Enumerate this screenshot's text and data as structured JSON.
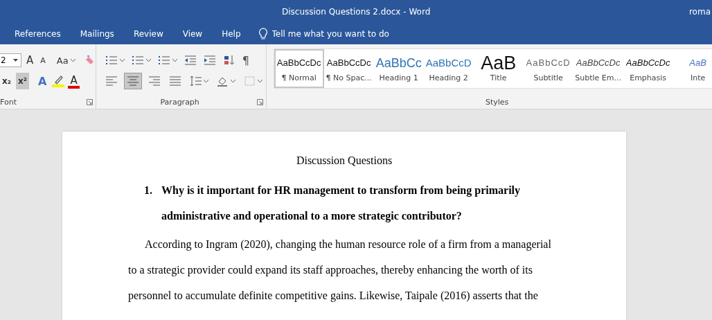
{
  "window": {
    "title": "Discussion Questions 2.docx  -  Word",
    "user": "roma"
  },
  "tabs": [
    {
      "label": "References",
      "selected": false
    },
    {
      "label": "Mailings",
      "selected": false
    },
    {
      "label": "Review",
      "selected": false
    },
    {
      "label": "View",
      "selected": false
    },
    {
      "label": "Help",
      "selected": false
    }
  ],
  "tell_me": {
    "placeholder": "Tell me what you want to do"
  },
  "font_group": {
    "label": "Font",
    "size": "2",
    "row1": [
      {
        "kind": "grow",
        "label": "A"
      },
      {
        "kind": "shrink",
        "label": "A"
      },
      {
        "kind": "case",
        "label": "Aa"
      },
      {
        "kind": "clear"
      }
    ],
    "row2": [
      {
        "kind": "subscript",
        "label": "x₂",
        "selected": false
      },
      {
        "kind": "superscript",
        "label": "x²",
        "selected": true
      },
      {
        "kind": "effects",
        "label": "A"
      },
      {
        "kind": "highlight"
      },
      {
        "kind": "color",
        "label": "A"
      }
    ]
  },
  "paragraph_group": {
    "label": "Paragraph",
    "row1": [
      {
        "kind": "bullets",
        "dropdown": true
      },
      {
        "kind": "numbering",
        "dropdown": true
      },
      {
        "kind": "multilevel",
        "dropdown": true
      },
      {
        "kind": "outdent",
        "dropdown": false
      },
      {
        "kind": "indent",
        "dropdown": false
      },
      {
        "kind": "sort",
        "dropdown": false
      },
      {
        "kind": "marks",
        "label": "¶",
        "dropdown": false
      }
    ],
    "row2": [
      {
        "kind": "align-left",
        "selected": false
      },
      {
        "kind": "align-center",
        "selected": true
      },
      {
        "kind": "align-right",
        "selected": false
      },
      {
        "kind": "justify",
        "selected": false
      },
      {
        "kind": "spacing",
        "selected": false
      },
      {
        "kind": "shading",
        "selected": false
      },
      {
        "kind": "borders",
        "selected": false
      }
    ]
  },
  "styles_group": {
    "label": "Styles",
    "items": [
      {
        "kind": "normal",
        "preview": "AaBbCcDc",
        "name": "¶ Normal",
        "selected": true
      },
      {
        "kind": "plain",
        "preview": "AaBbCcDc",
        "name": "¶ No Spac...",
        "selected": false
      },
      {
        "kind": "heading1",
        "preview": "AaBbCc",
        "name": "Heading 1",
        "selected": false
      },
      {
        "kind": "heading2",
        "preview": "AaBbCcD",
        "name": "Heading 2",
        "selected": false
      },
      {
        "kind": "title",
        "preview": "AaB",
        "name": "Title",
        "selected": false
      },
      {
        "kind": "subtitle",
        "preview": "AaBbCcD",
        "name": "Subtitle",
        "selected": false
      },
      {
        "kind": "subtle",
        "preview": "AaBbCcDc",
        "name": "Subtle Em...",
        "selected": false
      },
      {
        "kind": "emphasis",
        "preview": "AaBbCcDc",
        "name": "Emphasis",
        "selected": false
      },
      {
        "kind": "intense",
        "preview": "AaB",
        "name": "Inte",
        "selected": false
      }
    ]
  },
  "document": {
    "heading": "Discussion Questions",
    "question": {
      "number": "1.",
      "text": "Why is it important for HR management to transform from being primarily administrative and operational to a more strategic contributor?"
    },
    "paragraph": "According to Ingram (2020), changing the human resource role of a firm from a managerial to a strategic provider could expand its staff approaches, thereby enhancing the worth of its personnel to accumulate definite competitive gains. Likewise, Taipale (2016) asserts that the"
  }
}
